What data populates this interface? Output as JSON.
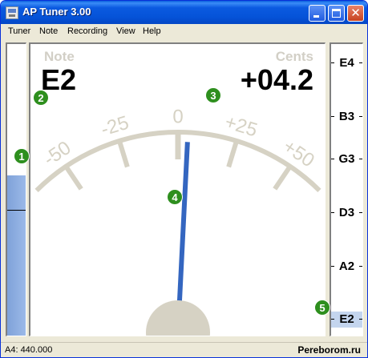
{
  "window": {
    "title": "AP Tuner 3.00"
  },
  "menu": [
    "Tuner",
    "Note",
    "Recording",
    "View",
    "Help"
  ],
  "display": {
    "note_label": "Note",
    "note_value": "E2",
    "cents_label": "Cents",
    "cents_value": "+04.2",
    "scale_labels": [
      "-50",
      "-25",
      "0",
      "+25",
      "+50"
    ],
    "needle_cents": 4.2,
    "input_level": 0.55,
    "needle_color": "#3466C0",
    "dial_color": "#D6D2C4"
  },
  "strings": [
    {
      "name": "E4",
      "active": false
    },
    {
      "name": "B3",
      "active": false
    },
    {
      "name": "G3",
      "active": false
    },
    {
      "name": "D3",
      "active": false
    },
    {
      "name": "A2",
      "active": false
    },
    {
      "name": "E2",
      "active": true
    }
  ],
  "callouts": [
    "1",
    "2",
    "3",
    "4",
    "5"
  ],
  "status": {
    "reference": "A4: 440.000",
    "watermark": "Pereborom.ru"
  }
}
